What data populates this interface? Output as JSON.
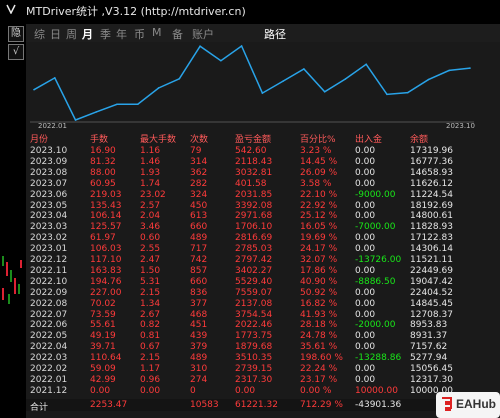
{
  "window": {
    "title": "MTDriver统计 ,V3.12 (http://mtdriver.cn)"
  },
  "side_buttons": [
    "隐",
    "√"
  ],
  "tabs": [
    {
      "label": "综",
      "active": false
    },
    {
      "label": "日",
      "active": false
    },
    {
      "label": "周",
      "active": false
    },
    {
      "label": "月",
      "active": true
    },
    {
      "label": "季",
      "active": false
    },
    {
      "label": "年",
      "active": false
    },
    {
      "label": "币",
      "active": false
    },
    {
      "label": "M",
      "active": false
    },
    {
      "label": "备",
      "active": false
    },
    {
      "label": "账户",
      "active": false
    },
    {
      "label": "路径",
      "active": false
    }
  ],
  "chart_data": {
    "type": "line",
    "x": [
      "2022.01",
      "2022.02",
      "2022.03",
      "2022.04",
      "2022.05",
      "2022.06",
      "2022.07",
      "2022.08",
      "2022.09",
      "2022.10",
      "2022.11",
      "2022.12",
      "2023.01",
      "2023.02",
      "2023.03",
      "2023.04",
      "2023.05",
      "2023.06",
      "2023.07",
      "2023.08",
      "2023.09",
      "2023.10"
    ],
    "series": [
      {
        "values": [
          12317.3,
          15056.45,
          5277.94,
          7157.62,
          8931.37,
          8953.83,
          12708.37,
          14845.45,
          22404.52,
          19047.42,
          22449.69,
          11521.11,
          14306.14,
          17122.83,
          11828.93,
          14800.61,
          18192.69,
          11224.54,
          11626.12,
          14658.93,
          16777.36,
          17319.96
        ],
        "color": "#29a3e8"
      }
    ],
    "xlabels": {
      "start": "2022.01",
      "end": "2023.10"
    },
    "grid": false
  },
  "table": {
    "headers": [
      "月份",
      "手数",
      "最大手数",
      "次数",
      "盈亏金额",
      "百分比%",
      "出入金",
      "余额"
    ],
    "rows": [
      [
        "2023.10",
        "16.90",
        "1.16",
        "79",
        "542.60",
        "3.23 %",
        "0.00",
        "17319.96"
      ],
      [
        "2023.09",
        "81.32",
        "1.46",
        "314",
        "2118.43",
        "14.45 %",
        "0.00",
        "16777.36"
      ],
      [
        "2023.08",
        "88.00",
        "1.93",
        "362",
        "3032.81",
        "26.09 %",
        "0.00",
        "14658.93"
      ],
      [
        "2023.07",
        "60.95",
        "1.74",
        "282",
        "401.58",
        "3.58 %",
        "0.00",
        "11626.12"
      ],
      [
        "2023.06",
        "219.03",
        "23.02",
        "324",
        "2031.85",
        "22.10 %",
        "-9000.00",
        "11224.54"
      ],
      [
        "2023.05",
        "135.43",
        "2.57",
        "450",
        "3392.08",
        "22.92 %",
        "0.00",
        "18192.69"
      ],
      [
        "2023.04",
        "106.14",
        "2.04",
        "613",
        "2971.68",
        "25.12 %",
        "0.00",
        "14800.61"
      ],
      [
        "2023.03",
        "125.57",
        "3.46",
        "660",
        "1706.10",
        "16.05 %",
        "-7000.00",
        "11828.93"
      ],
      [
        "2023.02",
        "61.97",
        "0.60",
        "489",
        "2816.69",
        "19.69 %",
        "0.00",
        "17122.83"
      ],
      [
        "2023.01",
        "106.03",
        "2.55",
        "717",
        "2785.03",
        "24.17 %",
        "0.00",
        "14306.14"
      ],
      [
        "2022.12",
        "117.10",
        "2.47",
        "742",
        "2797.42",
        "32.07 %",
        "-13726.00",
        "11521.11"
      ],
      [
        "2022.11",
        "163.83",
        "1.50",
        "857",
        "3402.27",
        "17.86 %",
        "0.00",
        "22449.69"
      ],
      [
        "2022.10",
        "194.76",
        "5.31",
        "660",
        "5529.40",
        "40.90 %",
        "-8886.50",
        "19047.42"
      ],
      [
        "2022.09",
        "227.00",
        "2.15",
        "836",
        "7559.07",
        "50.92 %",
        "0.00",
        "22404.52"
      ],
      [
        "2022.08",
        "70.02",
        "1.34",
        "377",
        "2137.08",
        "16.82 %",
        "0.00",
        "14845.45"
      ],
      [
        "2022.07",
        "73.59",
        "2.67",
        "468",
        "3754.54",
        "41.93 %",
        "0.00",
        "12708.37"
      ],
      [
        "2022.06",
        "55.61",
        "0.82",
        "451",
        "2022.46",
        "28.18 %",
        "-2000.00",
        "8953.83"
      ],
      [
        "2022.05",
        "49.19",
        "0.81",
        "439",
        "1773.75",
        "24.78 %",
        "0.00",
        "8931.37"
      ],
      [
        "2022.04",
        "39.71",
        "0.67",
        "379",
        "1879.68",
        "35.61 %",
        "0.00",
        "7157.62"
      ],
      [
        "2022.03",
        "110.64",
        "2.15",
        "489",
        "3510.35",
        "198.60 %",
        "-13288.86",
        "5277.94"
      ],
      [
        "2022.02",
        "59.09",
        "1.17",
        "310",
        "2739.15",
        "22.24 %",
        "0.00",
        "15056.45"
      ],
      [
        "2022.01",
        "42.99",
        "0.96",
        "274",
        "2317.30",
        "23.17 %",
        "0.00",
        "12317.30"
      ],
      [
        "2021.12",
        "0.00",
        "0.00",
        "0",
        "0.00",
        "0.00 %",
        "10000.00",
        "10000.00"
      ]
    ],
    "summary": [
      "合计",
      "2253.47",
      "",
      "10583",
      "61221.32",
      "712.29 %",
      "-43901.36",
      ""
    ]
  },
  "watermark": {
    "text": "EAHub"
  },
  "colors": {
    "line": "#29a3e8",
    "loss": "#ff3b3b",
    "deposit": "#19e619",
    "accent_header": "#ff5a5a"
  }
}
